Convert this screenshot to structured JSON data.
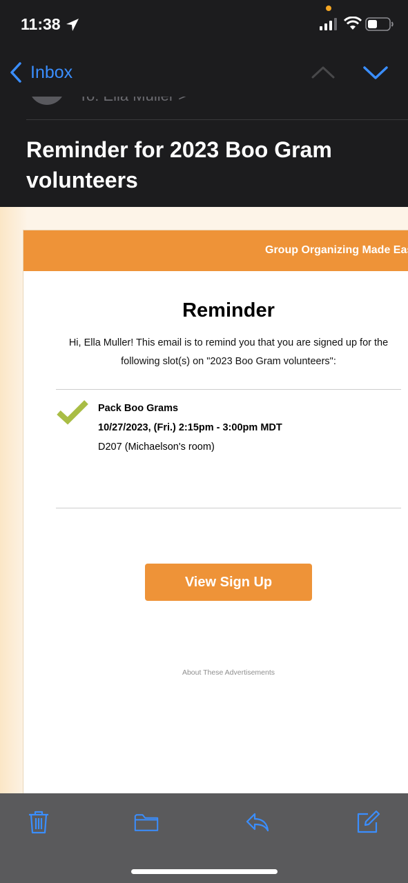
{
  "status_bar": {
    "time": "11:38",
    "icons": [
      "location-arrow-icon",
      "cellular-signal-icon",
      "wifi-icon",
      "battery-icon"
    ],
    "indicator_color": "#f5a623"
  },
  "nav": {
    "back_label": "Inbox",
    "back_icon": "chevron-left-icon",
    "up_icon": "chevron-up-icon",
    "down_icon": "chevron-down-icon"
  },
  "header": {
    "to_label": "To: Ella Muller >",
    "subject": "Reminder for 2023 Boo Gram volunteers"
  },
  "email": {
    "banner_text": "Group Organizing Made Easy",
    "title": "Reminder",
    "intro": "Hi, Ella Muller! This email is to remind you that you are signed up for the following slot(s) on \"2023 Boo Gram volunteers\":",
    "slot": {
      "name": "Pack Boo Grams",
      "datetime": "10/27/2023, (Fri.) 2:15pm - 3:00pm MDT",
      "location": "D207 (Michaelson's room)"
    },
    "button_label": "View Sign Up",
    "ad_link": "About These Advertisements"
  },
  "toolbar": {
    "icons": [
      "trash-icon",
      "folder-icon",
      "reply-icon",
      "compose-icon"
    ]
  },
  "colors": {
    "accent_blue": "#3a8eff",
    "brand_orange": "#ee9338",
    "check_green": "#a9bd45"
  }
}
